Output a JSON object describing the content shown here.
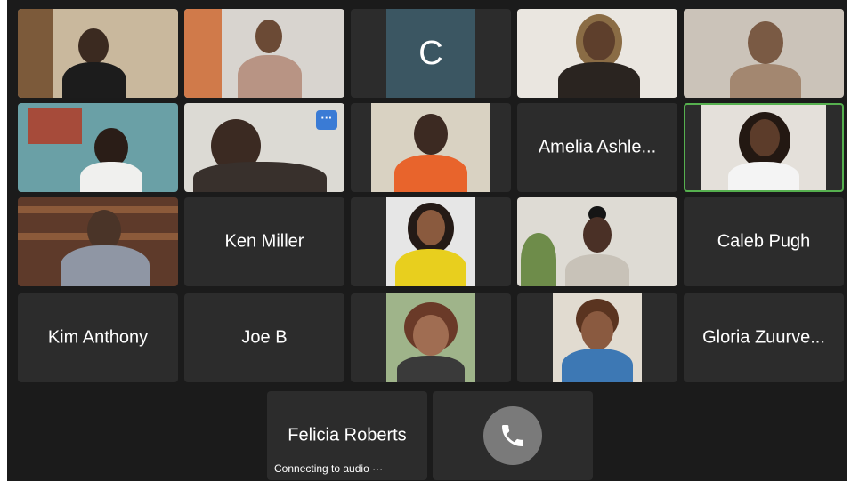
{
  "participants": {
    "c_initial": "C",
    "amelia": "Amelia Ashle...",
    "ken": "Ken Miller",
    "caleb": "Caleb Pugh",
    "kim": "Kim Anthony",
    "joe": "Joe B",
    "gloria": "Gloria Zuurve...",
    "felicia": "Felicia Roberts"
  },
  "more_button_label": "···",
  "audio_status": "Connecting to audio ···",
  "icons": {
    "more": "ellipsis-icon",
    "audio": "phone-icon"
  },
  "colors": {
    "background": "#1b1b1b",
    "tile": "#2c2c2c",
    "active_speaker_border": "#56b04f",
    "avatar_c": "#3b5662",
    "more_button": "#3a7bd5"
  }
}
